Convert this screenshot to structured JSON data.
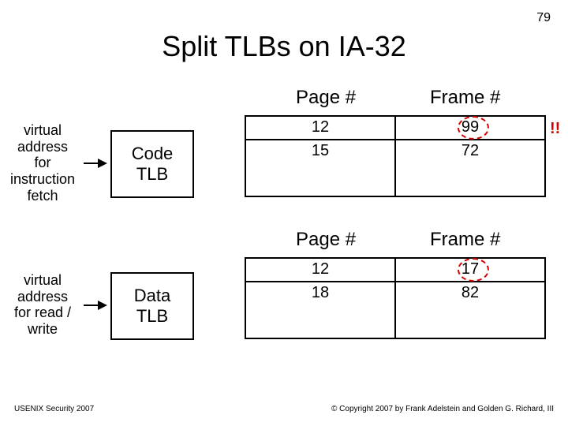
{
  "slide_number": "79",
  "title": "Split TLBs on IA-32",
  "headers": {
    "page": "Page #",
    "frame": "Frame #"
  },
  "code_tlb": {
    "label": "virtual\naddress\nfor\ninstruction\nfetch",
    "box": "Code\nTLB",
    "rows": [
      {
        "page": "12",
        "frame": "99"
      },
      {
        "page": "15",
        "frame": "72"
      }
    ]
  },
  "data_tlb": {
    "label": "virtual\naddress\nfor read /\nwrite",
    "box": "Data\nTLB",
    "rows": [
      {
        "page": "12",
        "frame": "17"
      },
      {
        "page": "18",
        "frame": "82"
      }
    ]
  },
  "bang": "!!",
  "footer": {
    "left": "USENIX Security 2007",
    "right": "© Copyright 2007 by Frank Adelstein and Golden G. Richard, III"
  }
}
